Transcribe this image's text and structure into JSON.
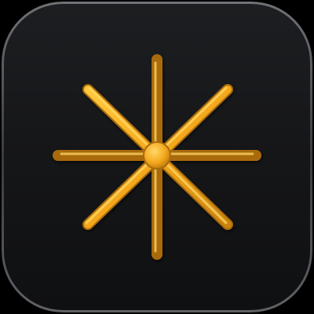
{
  "icon": {
    "semantic": "asterisk-star-icon",
    "colors": {
      "background": "#151618",
      "background_top": "#1c1d20",
      "rim_highlight": "#6b6d72",
      "symbol": "#f4a81c",
      "symbol_highlight": "#ffd15a",
      "symbol_shadow": "#b8740a",
      "page_background": "#000000"
    }
  }
}
